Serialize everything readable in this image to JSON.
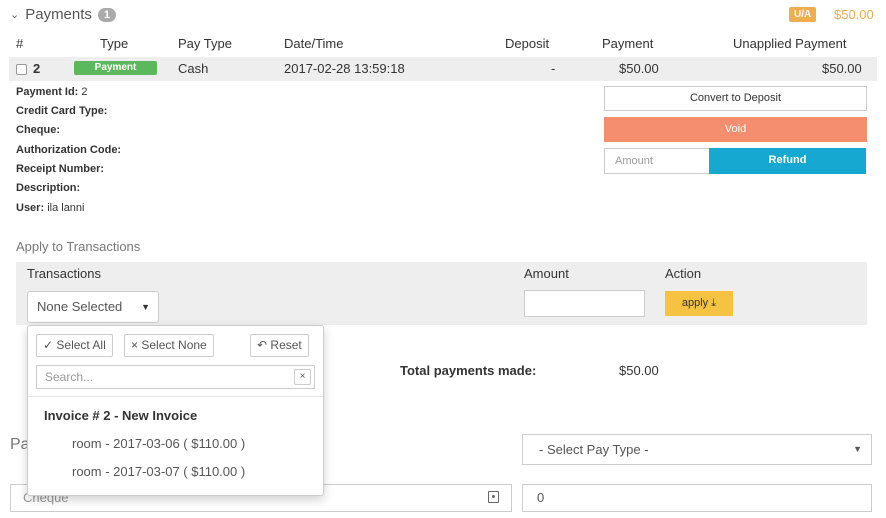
{
  "section": {
    "title": "Payments",
    "count": "1",
    "ua_badge": "U/A",
    "ua_amount": "$50.00"
  },
  "table": {
    "headers": [
      "#",
      "Type",
      "Pay Type",
      "Date/Time",
      "Deposit",
      "Payment",
      "Unapplied Payment"
    ],
    "row": {
      "id": "2",
      "type": "Payment",
      "pay_type": "Cash",
      "datetime": "2017-02-28 13:59:18",
      "deposit": "-",
      "payment": "$50.00",
      "unapplied": "$50.00"
    }
  },
  "details": [
    {
      "label": "Payment Id:",
      "value": "2"
    },
    {
      "label": "Credit Card Type:",
      "value": ""
    },
    {
      "label": "Cheque:",
      "value": ""
    },
    {
      "label": "Authorization Code:",
      "value": ""
    },
    {
      "label": "Receipt Number:",
      "value": ""
    },
    {
      "label": "Description:",
      "value": ""
    },
    {
      "label": "User:",
      "value": "ila lanni"
    }
  ],
  "actions": {
    "convert": "Convert to Deposit",
    "void": "Void",
    "amount_placeholder": "Amount",
    "refund": "Refund"
  },
  "apply": {
    "title": "Apply to Transactions",
    "col_transactions": "Transactions",
    "col_amount": "Amount",
    "col_action": "Action",
    "selector_value": "None Selected",
    "apply_button": "apply"
  },
  "dropdown": {
    "select_all": "Select All",
    "select_none": "Select None",
    "reset": "Reset",
    "search_placeholder": "Search...",
    "group": "Invoice # 2 - New Invoice",
    "options": [
      "room - 2017-03-06 ( $110.00 )",
      "room - 2017-03-07 ( $110.00 )"
    ]
  },
  "totals": {
    "label": "Total payments made:",
    "amount": "$50.00"
  },
  "form": {
    "partial_label": "Pa",
    "pay_type_placeholder": "- Select Pay Type -",
    "cheque_placeholder": "Cheque",
    "amount_value": "0"
  },
  "colors": {
    "payment_badge": "#5cb85c",
    "ua_badge": "#f0ad4e",
    "void": "#f58e6f",
    "refund": "#17a8d1",
    "apply": "#f5c242"
  }
}
